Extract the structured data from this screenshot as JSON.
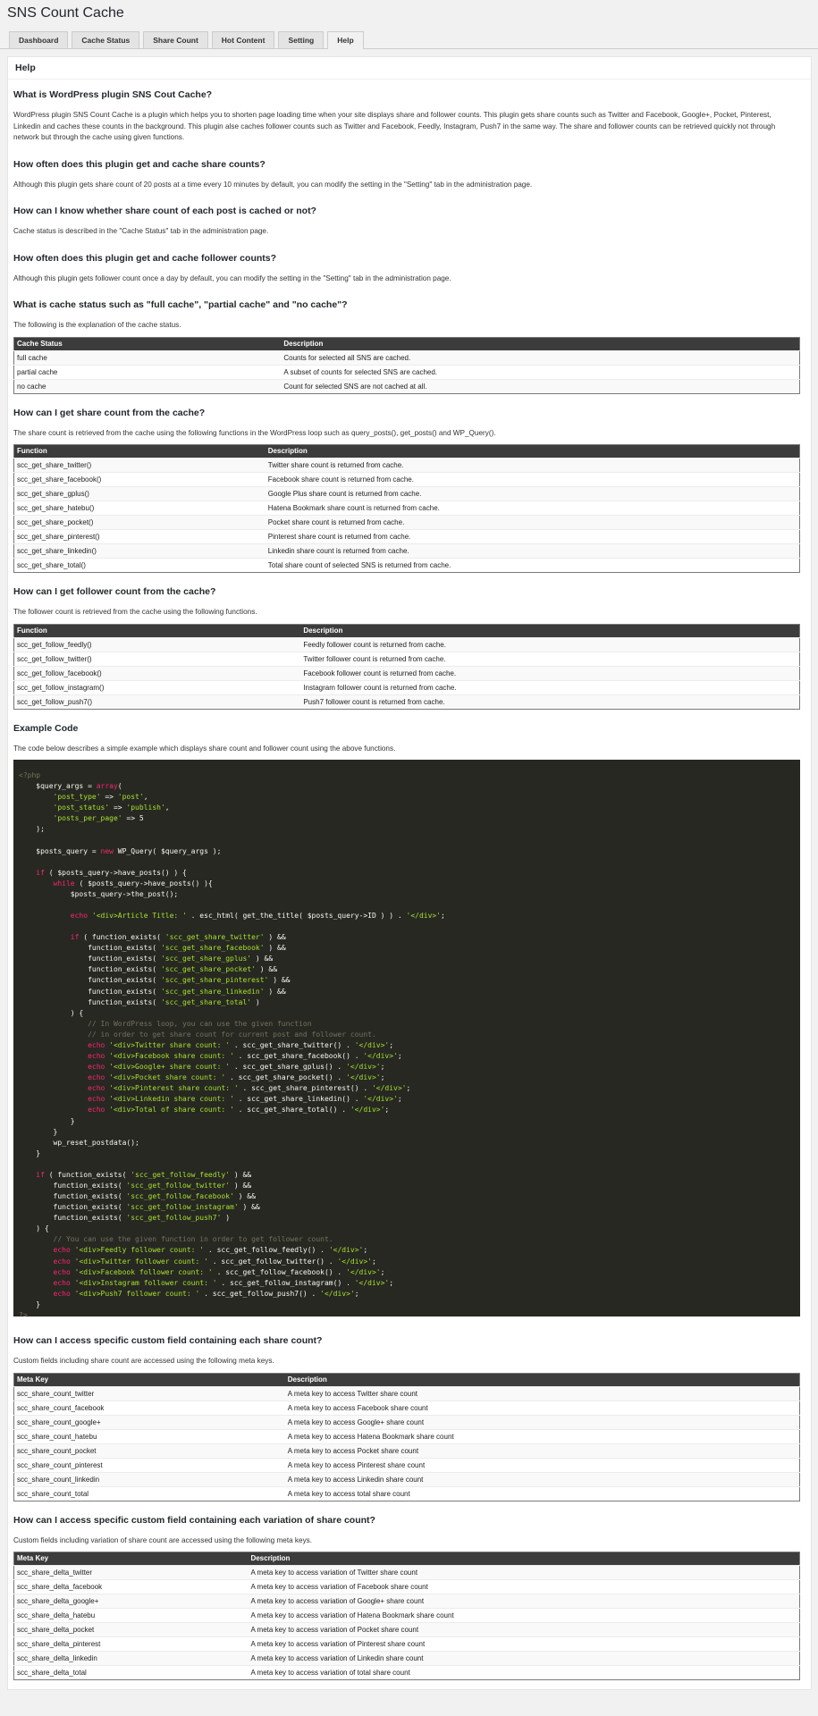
{
  "app": {
    "title": "SNS Count Cache"
  },
  "tabs": [
    "Dashboard",
    "Cache Status",
    "Share Count",
    "Hot Content",
    "Setting",
    "Help"
  ],
  "panel_title": "Help",
  "sections": {
    "s1": {
      "title": "What is WordPress plugin SNS Cout Cache?",
      "text": "WordPress plugin SNS Count Cache is a plugin which helps you to shorten page loading time when your site displays share and follower counts. This plugin gets share counts such as Twitter and Facebook, Google+, Pocket, Pinterest, Linkedin and caches these counts in the background. This plugin alse caches follower counts such as Twitter and Facebook, Feedly, Instagram, Push7 in the same way. The share and follower counts can be retrieved quickly not through network but through the cache using given functions."
    },
    "s2": {
      "title": "How often does this plugin get and cache share counts?",
      "text": "Although this plugin gets share count of 20 posts at a time every 10 minutes by default, you can modify the setting in the \"Setting\" tab in the administration page."
    },
    "s3": {
      "title": "How can I know whether share count of each post is cached or not?",
      "text": "Cache status is described in the \"Cache Status\" tab in the administration page."
    },
    "s4": {
      "title": "How often does this plugin get and cache follower counts?",
      "text": "Although this plugin gets follower count once a day by default, you can modify the setting in the \"Setting\" tab in the administration page."
    },
    "s5": {
      "title": "What is cache status such as \"full cache\", \"partial cache\" and \"no cache\"?",
      "text": "The following is the explanation of the cache status."
    },
    "s6": {
      "title": "How can I get share count from the cache?",
      "text": "The share count is retrieved from the cache using the following functions in the WordPress loop such as query_posts(), get_posts() and WP_Query()."
    },
    "s7": {
      "title": "How can I get follower count from the cache?",
      "text": "The follower count is retrieved from the cache using the following functions."
    },
    "s8": {
      "title": "Example Code",
      "text": "The code below describes a simple example which displays share count and follower count using the above functions."
    },
    "s9": {
      "title": "How can I access specific custom field containing each share count?",
      "text": "Custom fields including share count are accessed using the following meta keys."
    },
    "s10": {
      "title": "How can I access specific custom field containing each variation of share count?",
      "text": "Custom fields including variation of share count are accessed using the following meta keys."
    }
  },
  "tables": {
    "cache_status": {
      "headers": [
        "Cache Status",
        "Description"
      ],
      "rows": [
        [
          "full cache",
          "Counts for selected all SNS are cached."
        ],
        [
          "partial cache",
          "A subset of counts for selected SNS are cached."
        ],
        [
          "no cache",
          "Count for selected SNS are not cached at all."
        ]
      ]
    },
    "share_functions": {
      "headers": [
        "Function",
        "Description"
      ],
      "rows": [
        [
          "scc_get_share_twitter()",
          "Twitter share count is returned from cache."
        ],
        [
          "scc_get_share_facebook()",
          "Facebook share count is returned from cache."
        ],
        [
          "scc_get_share_gplus()",
          "Google Plus share count is returned from cache."
        ],
        [
          "scc_get_share_hatebu()",
          "Hatena Bookmark share count is returned from cache."
        ],
        [
          "scc_get_share_pocket()",
          "Pocket share count is returned from cache."
        ],
        [
          "scc_get_share_pinterest()",
          "Pinterest share count is returned from cache."
        ],
        [
          "scc_get_share_linkedin()",
          "Linkedin share count is returned from cache."
        ],
        [
          "scc_get_share_total()",
          "Total share count of selected SNS is returned from cache."
        ]
      ]
    },
    "follow_functions": {
      "headers": [
        "Function",
        "Description"
      ],
      "rows": [
        [
          "scc_get_follow_feedly()",
          "Feedly follower count is returned from cache."
        ],
        [
          "scc_get_follow_twitter()",
          "Twitter follower count is returned from cache."
        ],
        [
          "scc_get_follow_facebook()",
          "Facebook follower count is returned from cache."
        ],
        [
          "scc_get_follow_instagram()",
          "Instagram follower count is returned from cache."
        ],
        [
          "scc_get_follow_push7()",
          "Push7 follower count is returned from cache."
        ]
      ]
    },
    "share_meta": {
      "headers": [
        "Meta Key",
        "Description"
      ],
      "rows": [
        [
          "scc_share_count_twitter",
          "A meta key to access Twitter share count"
        ],
        [
          "scc_share_count_facebook",
          "A meta key to access Facebook share count"
        ],
        [
          "scc_share_count_google+",
          "A meta key to access Google+ share count"
        ],
        [
          "scc_share_count_hatebu",
          "A meta key to access Hatena Bookmark share count"
        ],
        [
          "scc_share_count_pocket",
          "A meta key to access Pocket share count"
        ],
        [
          "scc_share_count_pinterest",
          "A meta key to access Pinterest share count"
        ],
        [
          "scc_share_count_linkedin",
          "A meta key to access Linkedin share count"
        ],
        [
          "scc_share_count_total",
          "A meta key to access total share count"
        ]
      ]
    },
    "delta_meta": {
      "headers": [
        "Meta Key",
        "Description"
      ],
      "rows": [
        [
          "scc_share_delta_twitter",
          "A meta key to access variation of Twitter share count"
        ],
        [
          "scc_share_delta_facebook",
          "A meta key to access variation of Facebook share count"
        ],
        [
          "scc_share_delta_google+",
          "A meta key to access variation of Google+ share count"
        ],
        [
          "scc_share_delta_hatebu",
          "A meta key to access variation of Hatena Bookmark share count"
        ],
        [
          "scc_share_delta_pocket",
          "A meta key to access variation of Pocket share count"
        ],
        [
          "scc_share_delta_pinterest",
          "A meta key to access variation of Pinterest share count"
        ],
        [
          "scc_share_delta_linkedin",
          "A meta key to access variation of Linkedin share count"
        ],
        [
          "scc_share_delta_total",
          "A meta key to access variation of total share count"
        ]
      ]
    }
  },
  "code": {
    "lines": [
      [
        [
          "c",
          "<?php"
        ]
      ],
      [
        [
          "p",
          "    $query_args = "
        ],
        [
          "k",
          "array"
        ],
        [
          "p",
          "("
        ]
      ],
      [
        [
          "p",
          "        "
        ],
        [
          "s",
          "'post_type'"
        ],
        [
          "p",
          " => "
        ],
        [
          "s",
          "'post'"
        ],
        [
          "p",
          ","
        ]
      ],
      [
        [
          "p",
          "        "
        ],
        [
          "s",
          "'post_status'"
        ],
        [
          "p",
          " => "
        ],
        [
          "s",
          "'publish'"
        ],
        [
          "p",
          ","
        ]
      ],
      [
        [
          "p",
          "        "
        ],
        [
          "s",
          "'posts_per_page'"
        ],
        [
          "p",
          " => 5"
        ]
      ],
      [
        [
          "p",
          "    );"
        ]
      ],
      [
        [
          "p",
          ""
        ]
      ],
      [
        [
          "p",
          "    $posts_query = "
        ],
        [
          "k",
          "new"
        ],
        [
          "p",
          " WP_Query( $query_args );"
        ]
      ],
      [
        [
          "p",
          ""
        ]
      ],
      [
        [
          "p",
          "    "
        ],
        [
          "k",
          "if"
        ],
        [
          "p",
          " ( $posts_query->have_posts() ) {"
        ]
      ],
      [
        [
          "p",
          "        "
        ],
        [
          "k",
          "while"
        ],
        [
          "p",
          " ( $posts_query->have_posts() ){"
        ]
      ],
      [
        [
          "p",
          "            $posts_query->the_post();"
        ]
      ],
      [
        [
          "p",
          ""
        ]
      ],
      [
        [
          "p",
          "            "
        ],
        [
          "k",
          "echo"
        ],
        [
          "p",
          " "
        ],
        [
          "s",
          "'<div>Article Title: '"
        ],
        [
          "p",
          " . esc_html( get_the_title( $posts_query->ID ) ) . "
        ],
        [
          "s",
          "'</div>'"
        ],
        [
          "p",
          ";"
        ]
      ],
      [
        [
          "p",
          ""
        ]
      ],
      [
        [
          "p",
          "            "
        ],
        [
          "k",
          "if"
        ],
        [
          "p",
          " ( function_exists( "
        ],
        [
          "s",
          "'scc_get_share_twitter'"
        ],
        [
          "p",
          " ) &&"
        ]
      ],
      [
        [
          "p",
          "                function_exists( "
        ],
        [
          "s",
          "'scc_get_share_facebook'"
        ],
        [
          "p",
          " ) &&"
        ]
      ],
      [
        [
          "p",
          "                function_exists( "
        ],
        [
          "s",
          "'scc_get_share_gplus'"
        ],
        [
          "p",
          " ) &&"
        ]
      ],
      [
        [
          "p",
          "                function_exists( "
        ],
        [
          "s",
          "'scc_get_share_pocket'"
        ],
        [
          "p",
          " ) &&"
        ]
      ],
      [
        [
          "p",
          "                function_exists( "
        ],
        [
          "s",
          "'scc_get_share_pinterest'"
        ],
        [
          "p",
          " ) &&"
        ]
      ],
      [
        [
          "p",
          "                function_exists( "
        ],
        [
          "s",
          "'scc_get_share_linkedin'"
        ],
        [
          "p",
          " ) &&"
        ]
      ],
      [
        [
          "p",
          "                function_exists( "
        ],
        [
          "s",
          "'scc_get_share_total'"
        ],
        [
          "p",
          " )"
        ]
      ],
      [
        [
          "p",
          "            ) {"
        ]
      ],
      [
        [
          "c",
          "                // In WordPress loop, you can use the given function"
        ]
      ],
      [
        [
          "c",
          "                // in order to get share count for current post and follower count."
        ]
      ],
      [
        [
          "p",
          "                "
        ],
        [
          "k",
          "echo"
        ],
        [
          "p",
          " "
        ],
        [
          "s",
          "'<div>Twitter share count: '"
        ],
        [
          "p",
          " . scc_get_share_twitter() . "
        ],
        [
          "s",
          "'</div>'"
        ],
        [
          "p",
          ";"
        ]
      ],
      [
        [
          "p",
          "                "
        ],
        [
          "k",
          "echo"
        ],
        [
          "p",
          " "
        ],
        [
          "s",
          "'<div>Facebook share count: '"
        ],
        [
          "p",
          " . scc_get_share_facebook() . "
        ],
        [
          "s",
          "'</div>'"
        ],
        [
          "p",
          ";"
        ]
      ],
      [
        [
          "p",
          "                "
        ],
        [
          "k",
          "echo"
        ],
        [
          "p",
          " "
        ],
        [
          "s",
          "'<div>Google+ share count: '"
        ],
        [
          "p",
          " . scc_get_share_gplus() . "
        ],
        [
          "s",
          "'</div>'"
        ],
        [
          "p",
          ";"
        ]
      ],
      [
        [
          "p",
          "                "
        ],
        [
          "k",
          "echo"
        ],
        [
          "p",
          " "
        ],
        [
          "s",
          "'<div>Pocket share count: '"
        ],
        [
          "p",
          " . scc_get_share_pocket() . "
        ],
        [
          "s",
          "'</div>'"
        ],
        [
          "p",
          ";"
        ]
      ],
      [
        [
          "p",
          "                "
        ],
        [
          "k",
          "echo"
        ],
        [
          "p",
          " "
        ],
        [
          "s",
          "'<div>Pinterest share count: '"
        ],
        [
          "p",
          " . scc_get_share_pinterest() . "
        ],
        [
          "s",
          "'</div>'"
        ],
        [
          "p",
          ";"
        ]
      ],
      [
        [
          "p",
          "                "
        ],
        [
          "k",
          "echo"
        ],
        [
          "p",
          " "
        ],
        [
          "s",
          "'<div>Linkedin share count: '"
        ],
        [
          "p",
          " . scc_get_share_linkedin() . "
        ],
        [
          "s",
          "'</div>'"
        ],
        [
          "p",
          ";"
        ]
      ],
      [
        [
          "p",
          "                "
        ],
        [
          "k",
          "echo"
        ],
        [
          "p",
          " "
        ],
        [
          "s",
          "'<div>Total of share count: '"
        ],
        [
          "p",
          " . scc_get_share_total() . "
        ],
        [
          "s",
          "'</div>'"
        ],
        [
          "p",
          ";"
        ]
      ],
      [
        [
          "p",
          "            }"
        ]
      ],
      [
        [
          "p",
          "        }"
        ]
      ],
      [
        [
          "p",
          "        wp_reset_postdata();"
        ]
      ],
      [
        [
          "p",
          "    }"
        ]
      ],
      [
        [
          "p",
          ""
        ]
      ],
      [
        [
          "p",
          "    "
        ],
        [
          "k",
          "if"
        ],
        [
          "p",
          " ( function_exists( "
        ],
        [
          "s",
          "'scc_get_follow_feedly'"
        ],
        [
          "p",
          " ) &&"
        ]
      ],
      [
        [
          "p",
          "        function_exists( "
        ],
        [
          "s",
          "'scc_get_follow_twitter'"
        ],
        [
          "p",
          " ) &&"
        ]
      ],
      [
        [
          "p",
          "        function_exists( "
        ],
        [
          "s",
          "'scc_get_follow_facebook'"
        ],
        [
          "p",
          " ) &&"
        ]
      ],
      [
        [
          "p",
          "        function_exists( "
        ],
        [
          "s",
          "'scc_get_follow_instagram'"
        ],
        [
          "p",
          " ) &&"
        ]
      ],
      [
        [
          "p",
          "        function_exists( "
        ],
        [
          "s",
          "'scc_get_follow_push7'"
        ],
        [
          "p",
          " )"
        ]
      ],
      [
        [
          "p",
          "    ) {"
        ]
      ],
      [
        [
          "c",
          "        // You can use the given function in order to get follower count."
        ]
      ],
      [
        [
          "p",
          "        "
        ],
        [
          "k",
          "echo"
        ],
        [
          "p",
          " "
        ],
        [
          "s",
          "'<div>Feedly follower count: '"
        ],
        [
          "p",
          " . scc_get_follow_feedly() . "
        ],
        [
          "s",
          "'</div>'"
        ],
        [
          "p",
          ";"
        ]
      ],
      [
        [
          "p",
          "        "
        ],
        [
          "k",
          "echo"
        ],
        [
          "p",
          " "
        ],
        [
          "s",
          "'<div>Twitter follower count: '"
        ],
        [
          "p",
          " . scc_get_follow_twitter() . "
        ],
        [
          "s",
          "'</div>'"
        ],
        [
          "p",
          ";"
        ]
      ],
      [
        [
          "p",
          "        "
        ],
        [
          "k",
          "echo"
        ],
        [
          "p",
          " "
        ],
        [
          "s",
          "'<div>Facebook follower count: '"
        ],
        [
          "p",
          " . scc_get_follow_facebook() . "
        ],
        [
          "s",
          "'</div>'"
        ],
        [
          "p",
          ";"
        ]
      ],
      [
        [
          "p",
          "        "
        ],
        [
          "k",
          "echo"
        ],
        [
          "p",
          " "
        ],
        [
          "s",
          "'<div>Instagram follower count: '"
        ],
        [
          "p",
          " . scc_get_follow_instagram() . "
        ],
        [
          "s",
          "'</div>'"
        ],
        [
          "p",
          ";"
        ]
      ],
      [
        [
          "p",
          "        "
        ],
        [
          "k",
          "echo"
        ],
        [
          "p",
          " "
        ],
        [
          "s",
          "'<div>Push7 follower count: '"
        ],
        [
          "p",
          " . scc_get_follow_push7() . "
        ],
        [
          "s",
          "'</div>'"
        ],
        [
          "p",
          ";"
        ]
      ],
      [
        [
          "p",
          "    }"
        ]
      ],
      [
        [
          "c",
          "?>"
        ]
      ]
    ]
  }
}
